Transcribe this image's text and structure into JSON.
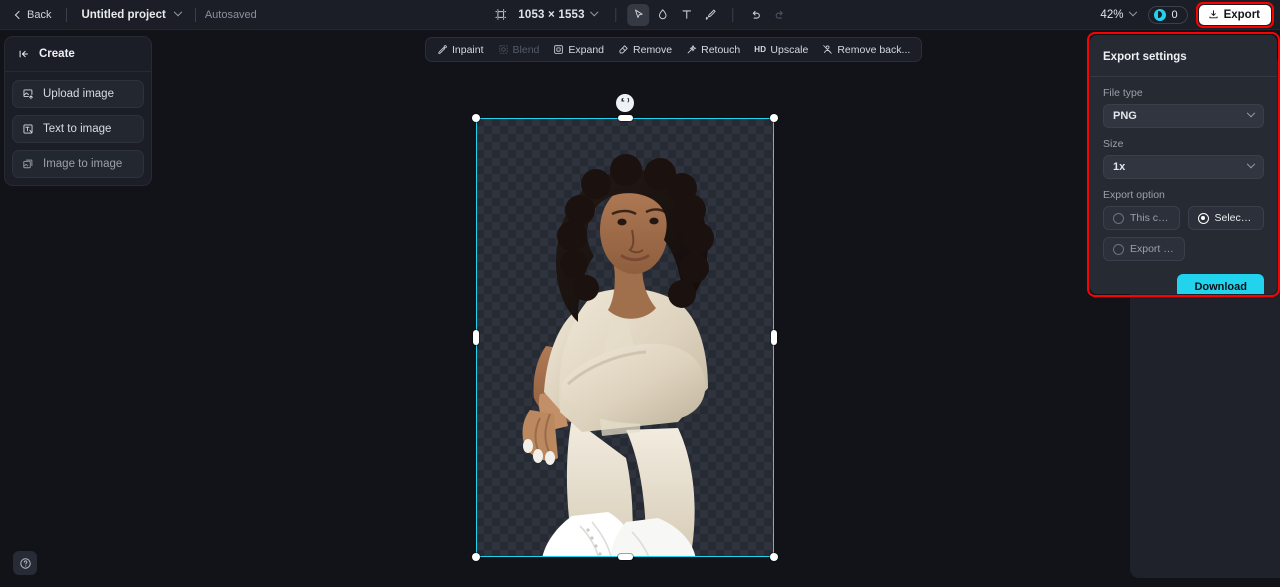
{
  "topbar": {
    "back_label": "Back",
    "project_name": "Untitled project",
    "autosaved_label": "Autosaved",
    "canvas_dimensions": "1053 × 1553",
    "zoom_level": "42%",
    "credits_count": "0",
    "export_label": "Export",
    "tools": [
      {
        "name": "frame-icon",
        "label": "Frame"
      },
      {
        "name": "select-icon",
        "label": "Select",
        "active": true
      },
      {
        "name": "eraser-icon",
        "label": "Eraser"
      },
      {
        "name": "text-icon",
        "label": "Text"
      },
      {
        "name": "brush-icon",
        "label": "Brush"
      },
      {
        "name": "undo-icon",
        "label": "Undo"
      },
      {
        "name": "redo-icon",
        "label": "Redo"
      }
    ]
  },
  "create_panel": {
    "title": "Create",
    "items": [
      {
        "label": "Upload image",
        "icon": "upload-image-icon"
      },
      {
        "label": "Text to image",
        "icon": "text-to-image-icon"
      },
      {
        "label": "Image to image",
        "icon": "image-to-image-icon"
      }
    ]
  },
  "edit_toolbar": {
    "items": [
      {
        "label": "Inpaint",
        "icon": "inpaint-icon",
        "disabled": false
      },
      {
        "label": "Blend",
        "icon": "blend-icon",
        "disabled": true
      },
      {
        "label": "Expand",
        "icon": "expand-icon",
        "disabled": false
      },
      {
        "label": "Remove",
        "icon": "remove-icon",
        "disabled": false
      },
      {
        "label": "Retouch",
        "icon": "retouch-icon",
        "disabled": false
      },
      {
        "label": "Upscale",
        "icon": "upscale-icon",
        "badge": "HD",
        "disabled": false
      },
      {
        "label": "Remove back...",
        "icon": "remove-background-icon",
        "disabled": false
      }
    ]
  },
  "export_settings": {
    "title": "Export settings",
    "file_type_label": "File type",
    "file_type_value": "PNG",
    "size_label": "Size",
    "size_value": "1x",
    "export_option_label": "Export option",
    "options": [
      {
        "label": "This canvas",
        "selected": false
      },
      {
        "label": "Selected l...",
        "selected": true
      },
      {
        "label": "Export all ...",
        "selected": false
      }
    ],
    "download_label": "Download",
    "highlight_color": "#ff0000"
  },
  "help": {
    "icon": "help-icon"
  },
  "theme": {
    "accent": "#22d3ee",
    "panel_bg": "#262a33",
    "topbar_bg": "#1b1e26",
    "canvas_bg": "#111318"
  }
}
